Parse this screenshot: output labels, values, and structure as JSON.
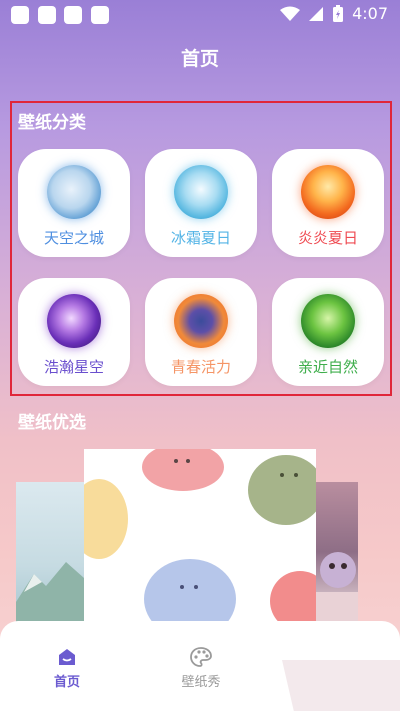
{
  "status_bar": {
    "time": "4:07"
  },
  "header": {
    "title": "首页"
  },
  "categories": {
    "title": "壁纸分类",
    "items": [
      {
        "label": "天空之城",
        "color": "#4f8fe0",
        "icon": "sky-castle-thumbnail"
      },
      {
        "label": "冰霜夏日",
        "color": "#54b4e6",
        "icon": "ice-summer-thumbnail"
      },
      {
        "label": "炎炎夏日",
        "color": "#ef4b52",
        "icon": "hot-summer-thumbnail"
      },
      {
        "label": "浩瀚星空",
        "color": "#6a4fce",
        "icon": "starry-sky-thumbnail"
      },
      {
        "label": "青春活力",
        "color": "#f59566",
        "icon": "youth-thumbnail"
      },
      {
        "label": "亲近自然",
        "color": "#3fae4c",
        "icon": "nature-thumbnail"
      }
    ]
  },
  "featured": {
    "title": "壁纸优选"
  },
  "bottom_nav": {
    "items": [
      {
        "label": "首页",
        "icon": "home-icon",
        "active": true,
        "color": "#6b5bd0"
      },
      {
        "label": "壁纸秀",
        "icon": "palette-icon",
        "active": false,
        "color": "#9a9a9a"
      }
    ]
  }
}
